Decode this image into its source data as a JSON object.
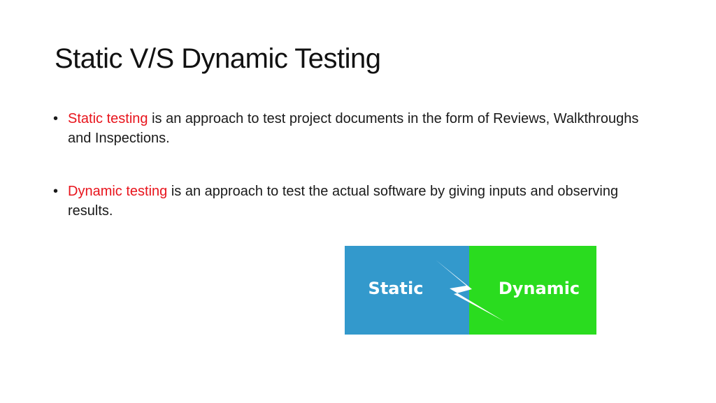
{
  "slide": {
    "title": "Static V/S Dynamic Testing",
    "bullets": [
      {
        "highlight": "Static testing",
        "text": " is an approach to test project documents in the form of Reviews, Walkthroughs and Inspections."
      },
      {
        "highlight": "Dynamic testing",
        "text": " is an approach to test the actual software by giving inputs and observing results."
      }
    ],
    "highlight_color": "#e8141c",
    "bullet_glyph": "•"
  },
  "figure": {
    "left_label": "Static",
    "right_label": "Dynamic",
    "left_color": "#3399cc",
    "right_color": "#2adc1f",
    "center_icon": "lightning-bolt-icon"
  }
}
